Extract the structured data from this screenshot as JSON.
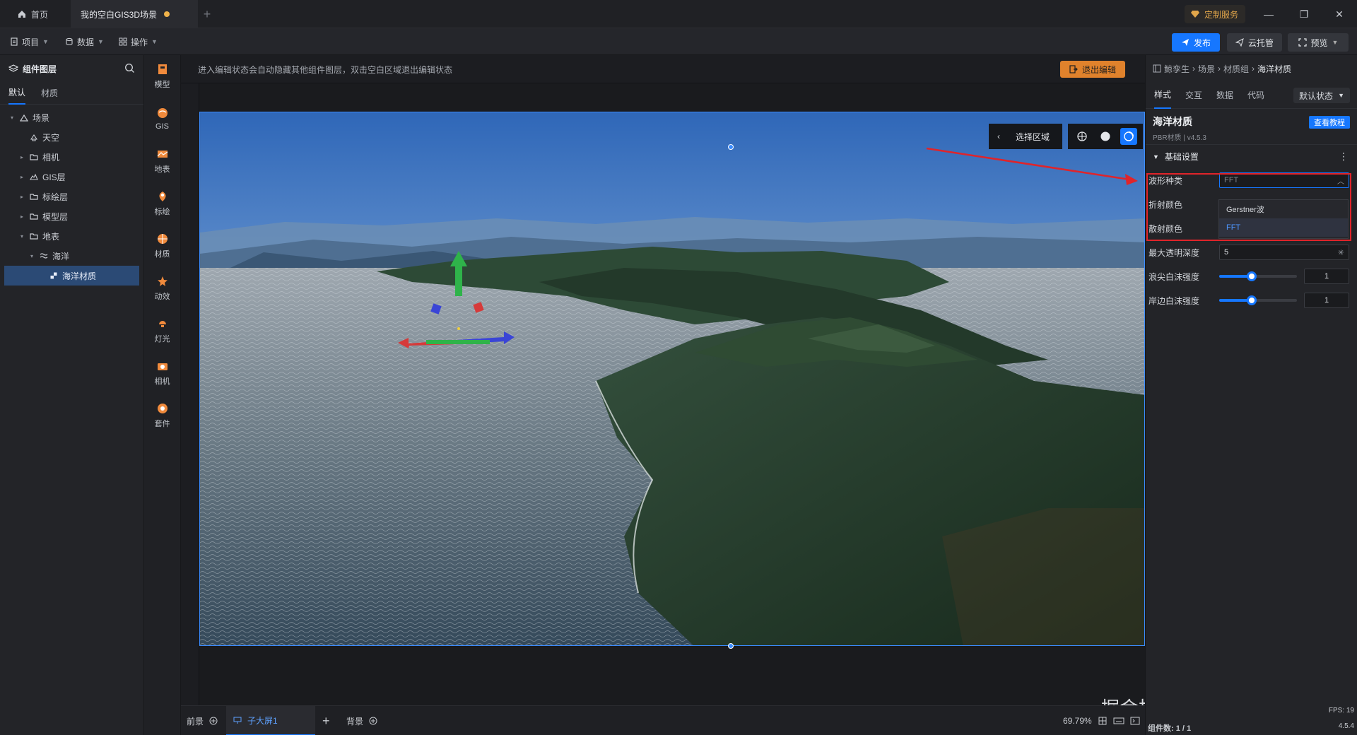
{
  "tabs": {
    "home": "首页",
    "scene": "我的空白GIS3D场景",
    "add": "+"
  },
  "custom_service": "定制服务",
  "window_controls": [
    "—",
    "❐",
    "✕"
  ],
  "menu": {
    "project": "项目",
    "data": "数据",
    "operate": "操作"
  },
  "actions": {
    "publish": "发布",
    "cloud": "云托管",
    "preview": "预览"
  },
  "layer_panel": {
    "title": "组件图层",
    "tabs": [
      "默认",
      "材质"
    ],
    "tree": [
      {
        "label": "场景",
        "level": 0,
        "arrow": "▾",
        "icon": "scene-icon"
      },
      {
        "label": "天空",
        "level": 1,
        "arrow": "",
        "icon": "sky-icon"
      },
      {
        "label": "相机",
        "level": 1,
        "arrow": "▸",
        "icon": "folder-icon"
      },
      {
        "label": "GIS层",
        "level": 1,
        "arrow": "▸",
        "icon": "gis-icon"
      },
      {
        "label": "标绘层",
        "level": 1,
        "arrow": "▸",
        "icon": "folder-icon"
      },
      {
        "label": "模型层",
        "level": 1,
        "arrow": "▸",
        "icon": "folder-icon"
      },
      {
        "label": "地表",
        "level": 1,
        "arrow": "▾",
        "icon": "folder-icon"
      },
      {
        "label": "海洋",
        "level": 2,
        "arrow": "▾",
        "icon": "wave-icon"
      },
      {
        "label": "海洋材质",
        "level": 3,
        "arrow": "",
        "icon": "material-icon",
        "selected": true
      }
    ]
  },
  "components": [
    "模型",
    "GIS",
    "地表",
    "标绘",
    "材质",
    "动效",
    "灯光",
    "相机",
    "套件"
  ],
  "canvas": {
    "notice": "进入编辑状态会自动隐藏其他组件图层，双击空白区域退出编辑状态",
    "exit_edit": "退出编辑",
    "select_area": "选择区域"
  },
  "bottom_bar": {
    "front": "前景",
    "child_screen": "子大屏1",
    "add": "+",
    "background": "背景",
    "zoom": "69.79%"
  },
  "properties": {
    "breadcrumb": [
      "鲸孪生",
      "场景",
      "材质组",
      "海洋材质"
    ],
    "tabs": [
      "样式",
      "交互",
      "数据",
      "代码"
    ],
    "state": "默认状态",
    "component_name": "海洋材质",
    "component_version": "PBR材质 | v4.5.3",
    "tutorial": "查看教程",
    "section": "基础设置",
    "wave_type_label": "波形种类",
    "wave_type_value": "FFT",
    "wave_options": [
      "Gerstner波",
      "FFT"
    ],
    "refraction_color_label": "折射颜色",
    "scatter_color_label": "散射颜色",
    "max_depth_label": "最大透明深度",
    "max_depth_value": "5",
    "crest_foam_label": "浪尖白沫强度",
    "crest_foam_value": "1",
    "crest_foam_level": 0.42,
    "shore_foam_label": "岸边白沫强度",
    "shore_foam_value": "1",
    "shore_foam_level": 0.42
  },
  "status": {
    "component_count": "组件数: 1 / 1",
    "fps": "FPS: 19",
    "version": "4.5.4"
  },
  "watermark": "掘金技术社区 @ 山海鲸可视化",
  "colors": {
    "accent": "#1677ff",
    "exit_edit": "#e0822c",
    "highlight": "#e0242a",
    "custom_service": "#e2a64a"
  }
}
